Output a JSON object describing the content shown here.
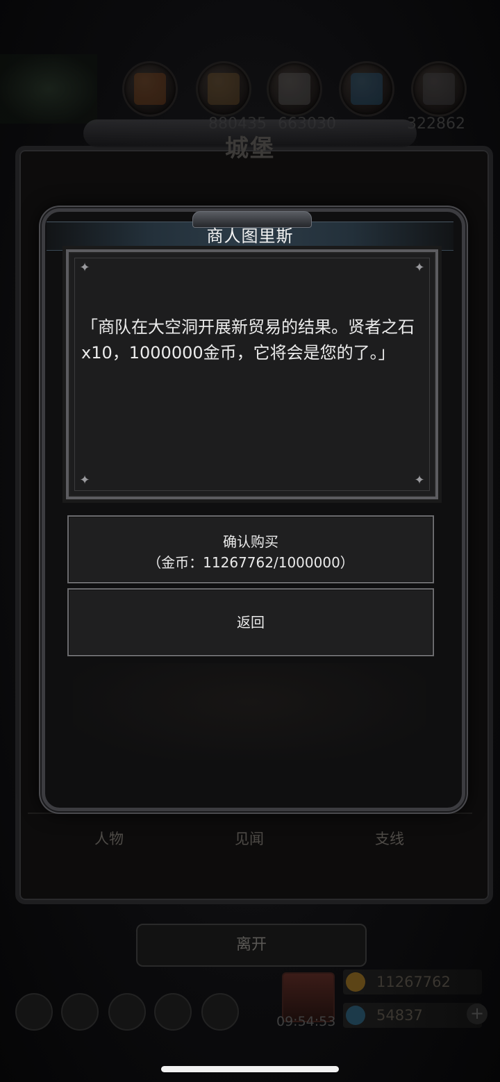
{
  "background": {
    "castle_title": "城堡",
    "resource_values": [
      "880435",
      "663030",
      "322862"
    ],
    "tabs": [
      "人物",
      "见闻",
      "支线"
    ],
    "leave_button": "离开",
    "timer": "09:54:53",
    "gold_amount": "11267762",
    "gem_amount": "54837",
    "icon_names": [
      "tree-icon",
      "wood-icon",
      "plank-icon",
      "stone-icon",
      "crystal-icon",
      "iron-icon"
    ]
  },
  "dialog": {
    "title": "商人图里斯",
    "message": "「商队在大空洞开展新贸易的结果。贤者之石x10，1000000金币，它将会是您的了。」",
    "confirm_label": "确认购买",
    "confirm_cost": "（金币：11267762/1000000）",
    "back_label": "返回"
  },
  "colors": {
    "dialog_bg": "#0f0f10",
    "panel_bg": "#1d1d1e",
    "title_bar": "#2c3b47",
    "text": "#ececec"
  }
}
